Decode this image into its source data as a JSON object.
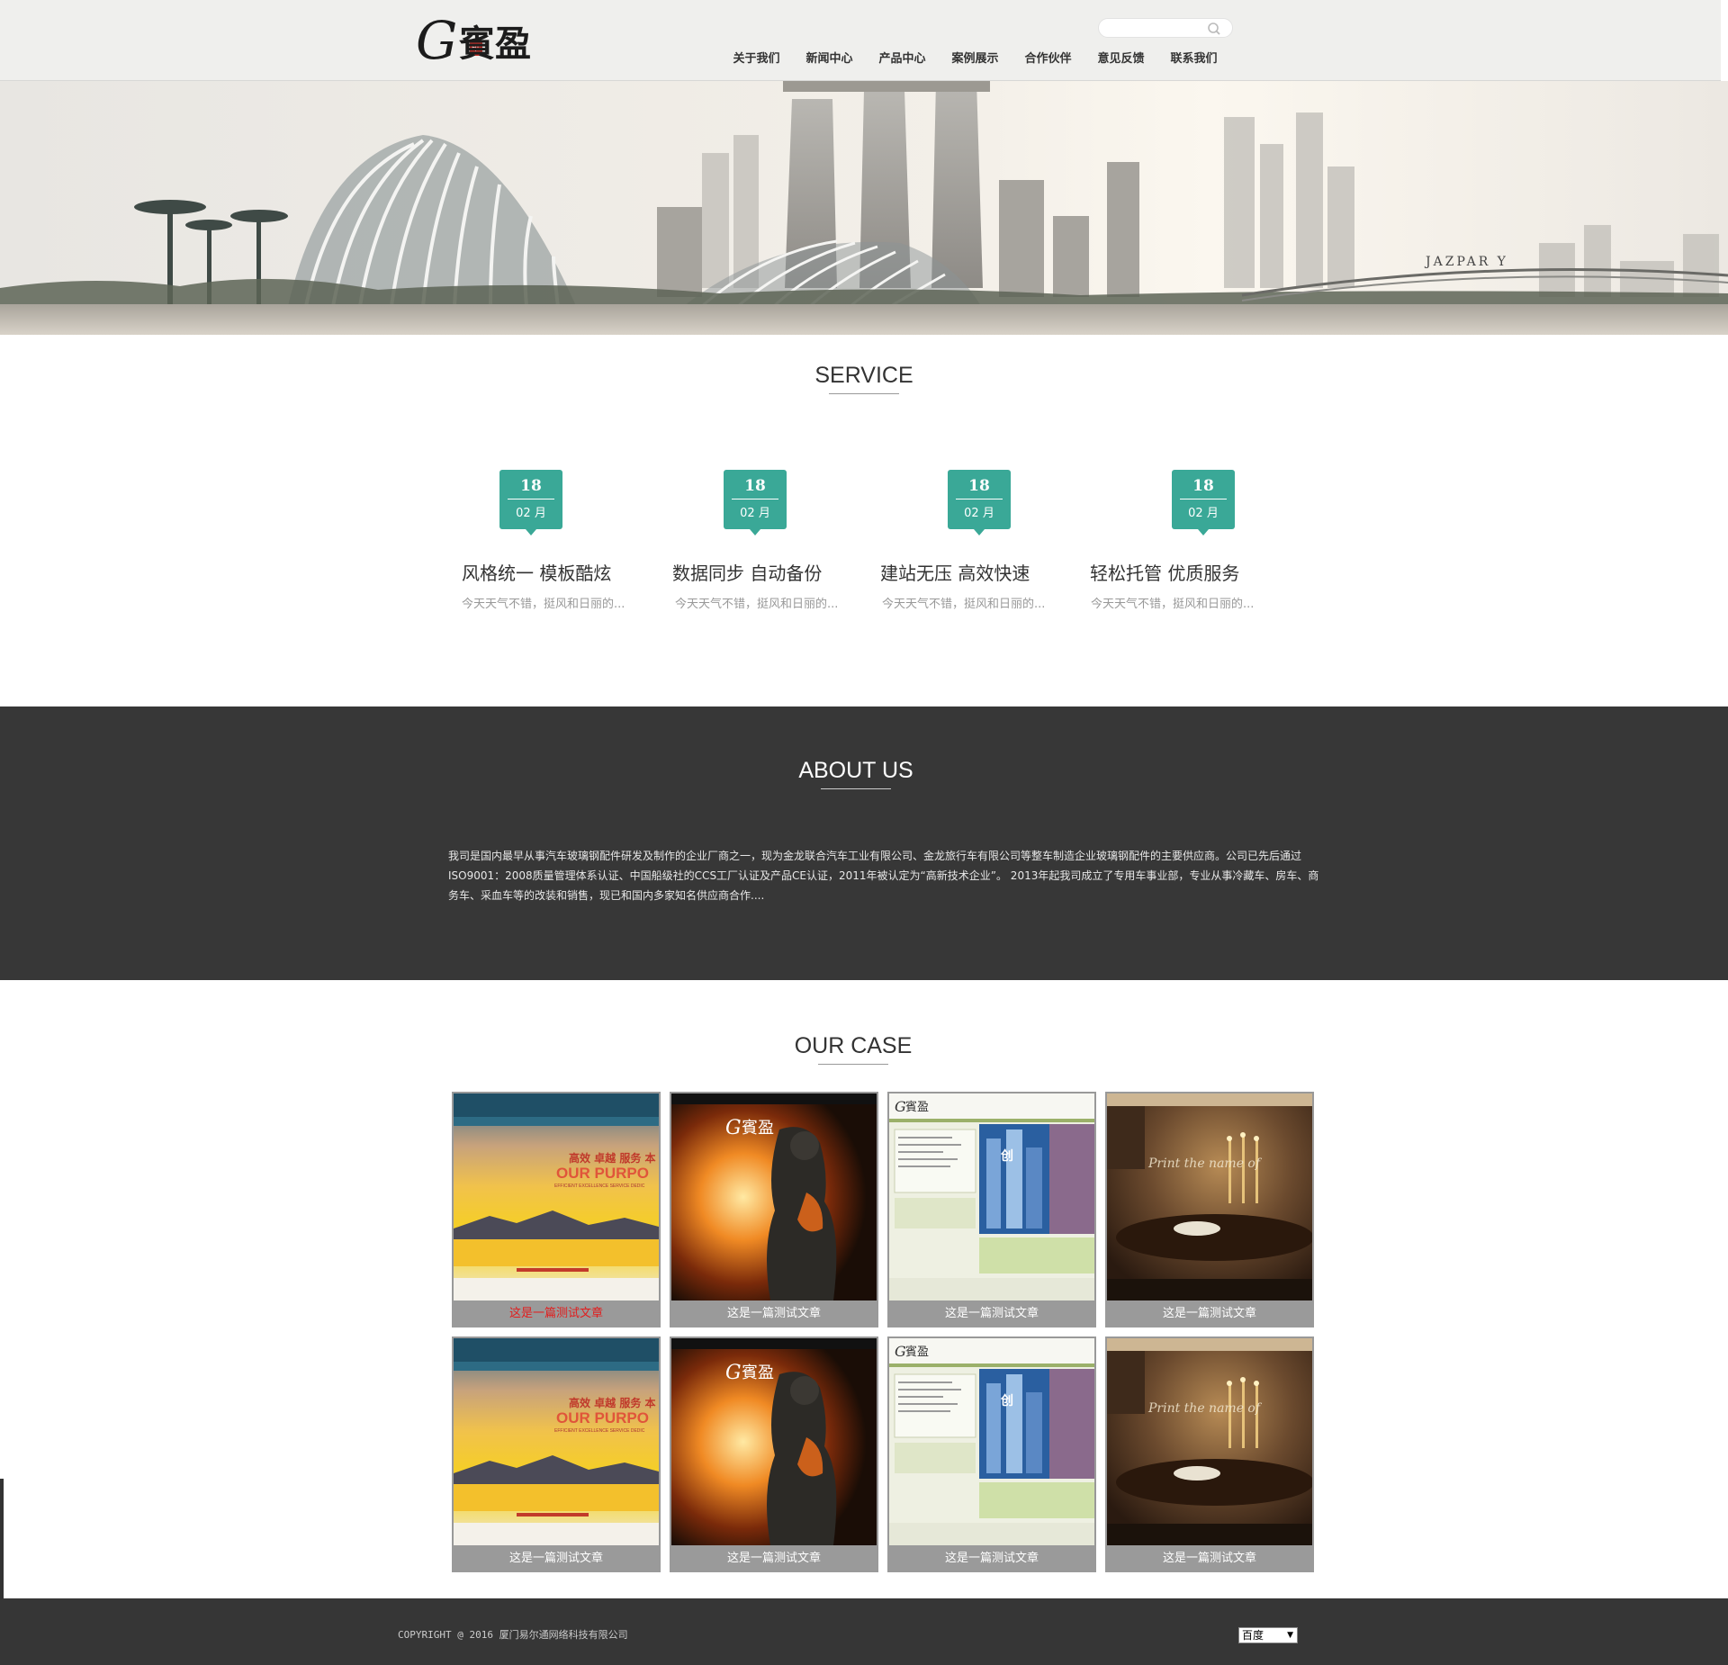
{
  "header": {
    "logo_text": "G賓盈",
    "search": {
      "placeholder": ""
    },
    "nav": [
      "关于我们",
      "新闻中心",
      "产品中心",
      "案例展示",
      "合作伙伴",
      "意见反馈",
      "联系我们"
    ]
  },
  "banner": {
    "tag": "JAZPAR Y"
  },
  "service": {
    "title": "SERVICE",
    "items": [
      {
        "day": "18",
        "month": "02 月",
        "title": "风格统一 模板酷炫",
        "desc": "今天天气不错，挺风和日丽的..."
      },
      {
        "day": "18",
        "month": "02 月",
        "title": "数据同步 自动备份",
        "desc": "今天天气不错，挺风和日丽的..."
      },
      {
        "day": "18",
        "month": "02 月",
        "title": "建站无压 高效快速",
        "desc": "今天天气不错，挺风和日丽的..."
      },
      {
        "day": "18",
        "month": "02 月",
        "title": "轻松托管 优质服务",
        "desc": "今天天气不错，挺风和日丽的..."
      }
    ]
  },
  "about": {
    "title": "ABOUT US",
    "text": "我司是国内最早从事汽车玻璃钢配件研发及制作的企业厂商之一，现为金龙联合汽车工业有限公司、金龙旅行车有限公司等整车制造企业玻璃钢配件的主要供应商。公司已先后通过ISO9001：2008质量管理体系认证、中国船级社的CCS工厂认证及产品CE认证，2011年被认定为“高新技术企业”。 2013年起我司成立了专用车事业部，专业从事冷藏车、房车、商务车、采血车等的改装和销售，现已和国内多家知名供应商合作...."
  },
  "cases": {
    "title": "OUR CASE",
    "items": [
      {
        "caption": "这是一篇测试文章",
        "theme": "sunset",
        "active": true
      },
      {
        "caption": "这是一篇测试文章",
        "theme": "soldier"
      },
      {
        "caption": "这是一篇测试文章",
        "theme": "green"
      },
      {
        "caption": "这是一篇测试文章",
        "theme": "dining"
      },
      {
        "caption": "这是一篇测试文章",
        "theme": "sunset"
      },
      {
        "caption": "这是一篇测试文章",
        "theme": "soldier"
      },
      {
        "caption": "这是一篇测试文章",
        "theme": "green"
      },
      {
        "caption": "这是一篇测试文章",
        "theme": "dining"
      }
    ],
    "thumb_text": {
      "sunset_cn": "高效 卓越 服务 本",
      "sunset_en": "OUR PURPO",
      "sunset_sub": "EFFICIENT EXCELLENCE SERVICE DEDIC",
      "dining_script": "Print the name of",
      "green_badge": "创"
    },
    "colors": {
      "active_caption": "#e21d1d",
      "caption": "#ffffff"
    }
  },
  "footer": {
    "copyright": "COPYRIGHT @ 2016 厦门易尔通网络科技有限公司",
    "select_value": "百度"
  },
  "colors": {
    "accent": "#3aa897",
    "about_bg": "#373737",
    "footer_bg": "#363636"
  }
}
